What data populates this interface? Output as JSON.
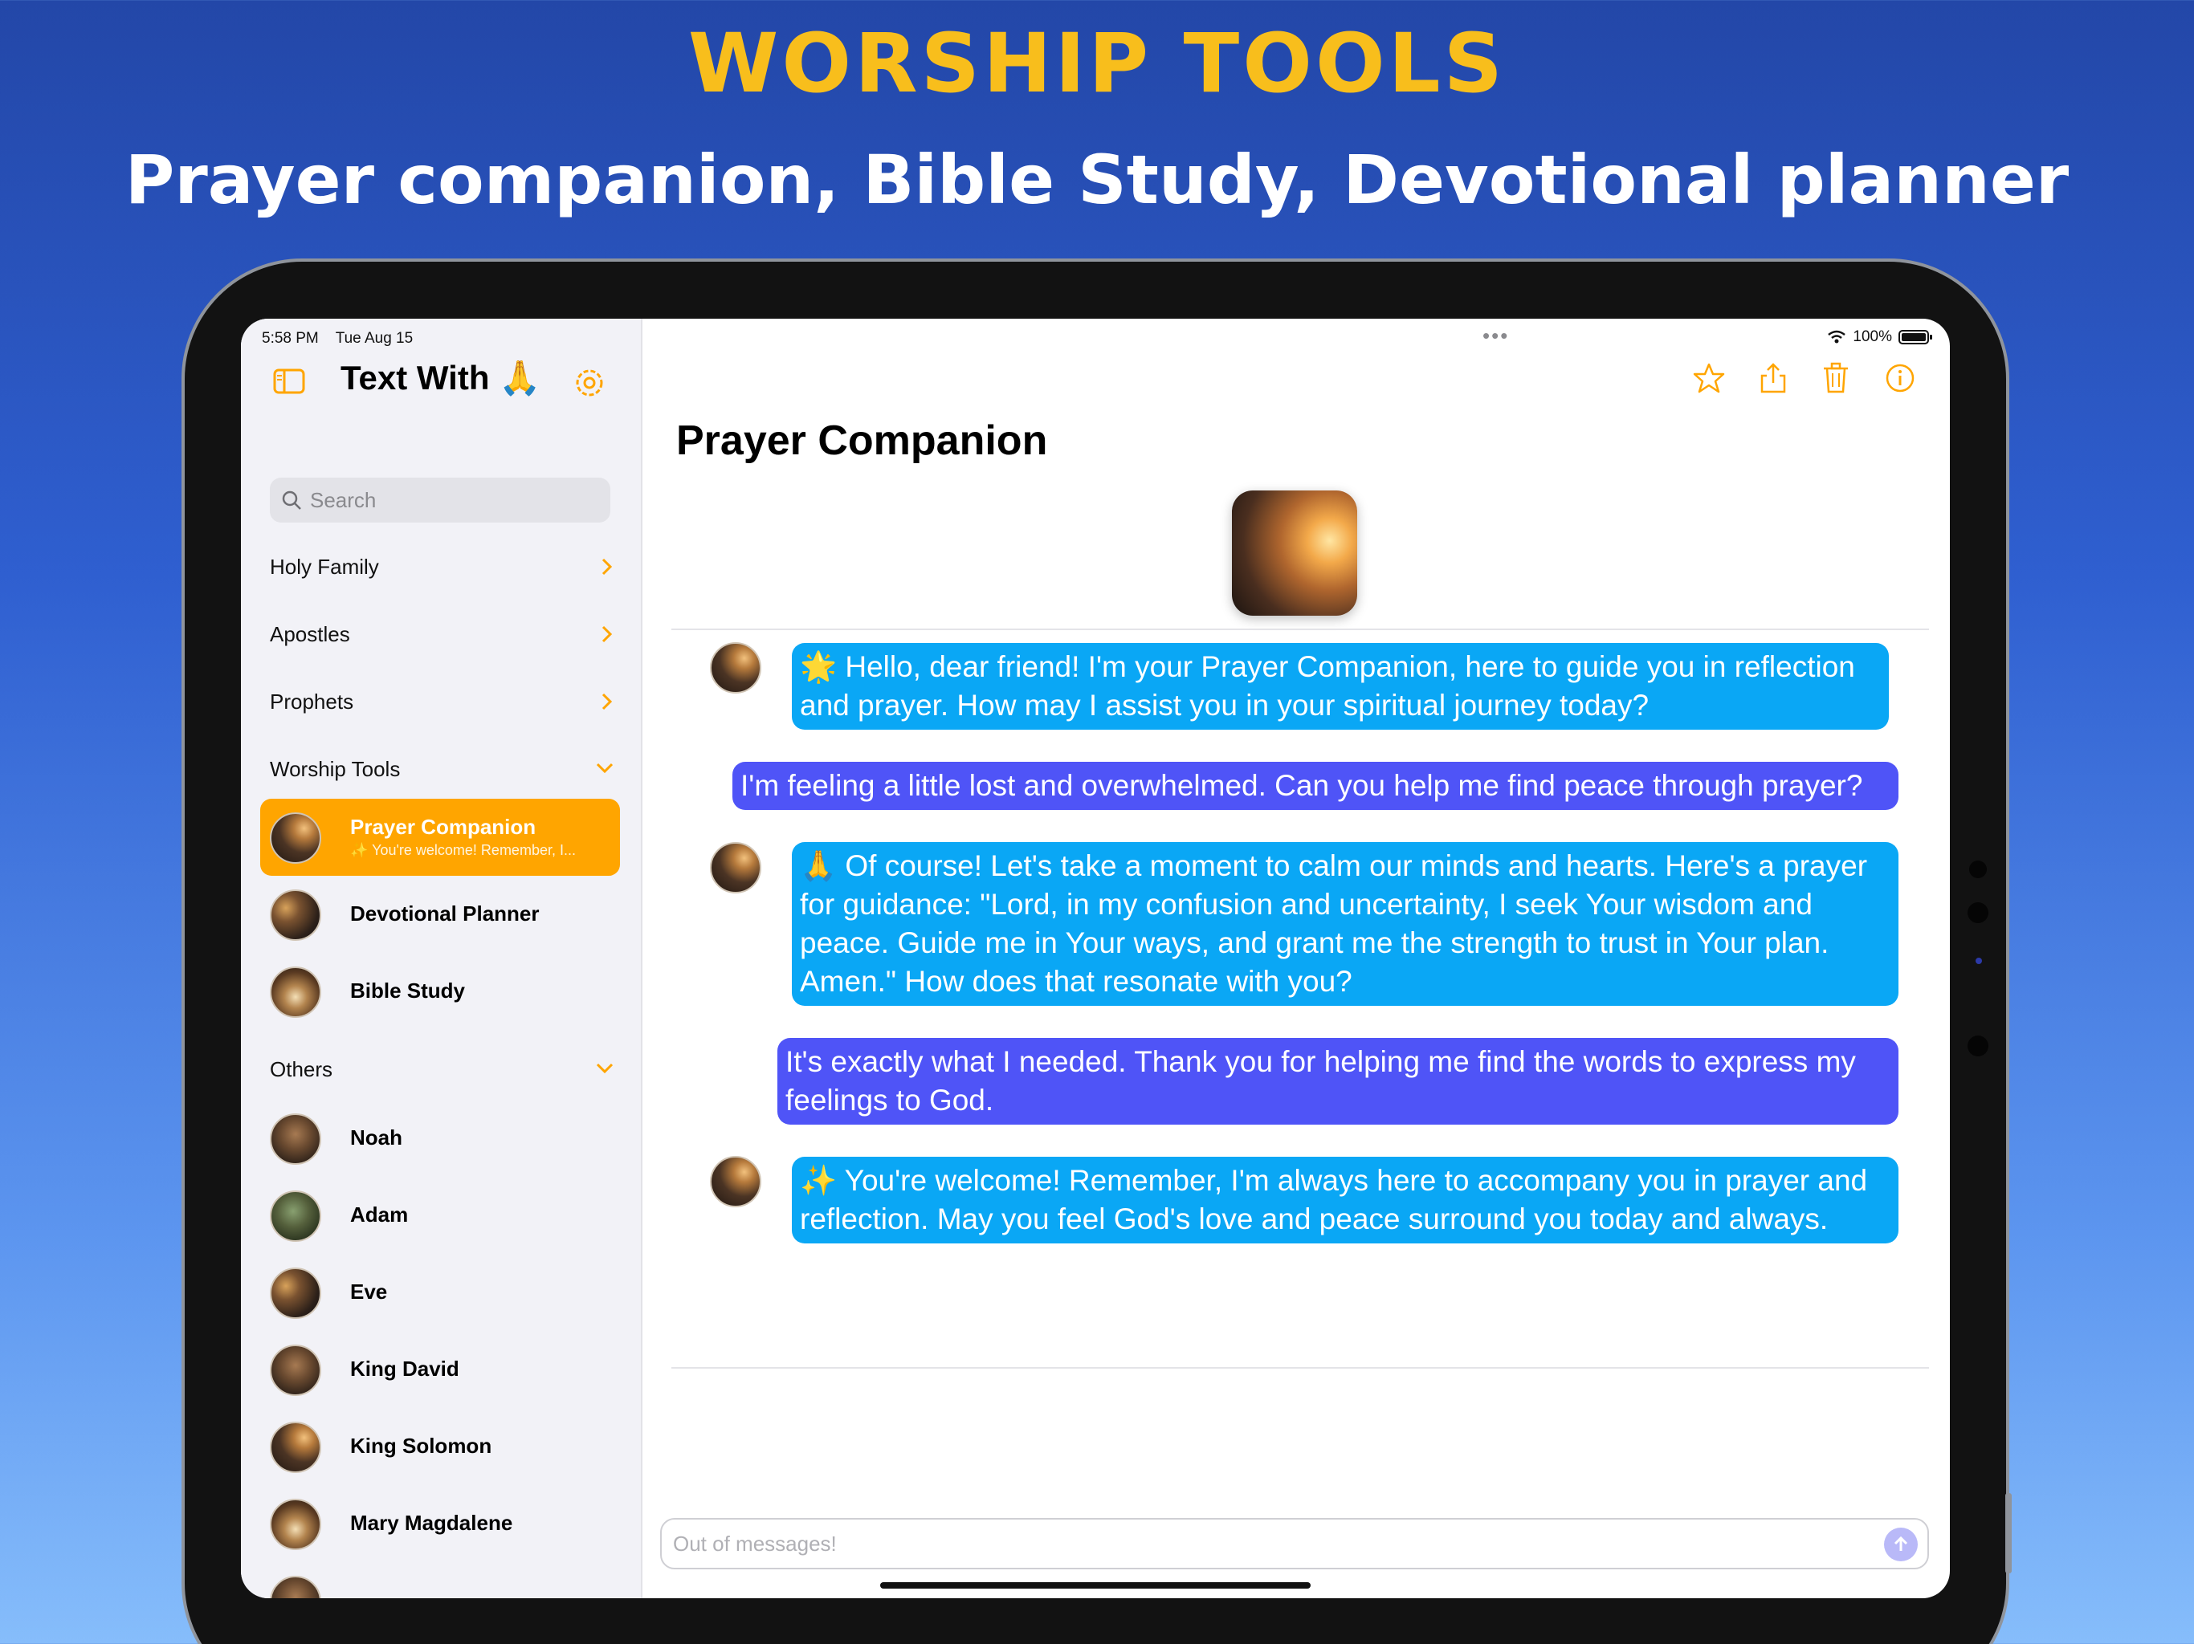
{
  "promo": {
    "title": "WORSHIP TOOLS",
    "subtitle": "Prayer companion, Bible Study, Devotional planner"
  },
  "status_bar": {
    "time": "5:58 PM",
    "date": "Tue Aug 15",
    "battery": "100%",
    "battery_level": 1.0
  },
  "sidebar": {
    "app_title": "Text With 🙏",
    "search_placeholder": "Search",
    "sections": [
      {
        "label": "Holy Family",
        "state": "collapsed"
      },
      {
        "label": "Apostles",
        "state": "collapsed"
      },
      {
        "label": "Prophets",
        "state": "collapsed"
      },
      {
        "label": "Worship Tools",
        "state": "expanded"
      }
    ],
    "worship_tools": [
      {
        "name": "Prayer Companion",
        "preview": "✨ You're welcome! Remember, I...",
        "selected": true
      },
      {
        "name": "Devotional Planner"
      },
      {
        "name": "Bible Study"
      }
    ],
    "others_label": "Others",
    "others": [
      {
        "name": "Noah"
      },
      {
        "name": "Adam"
      },
      {
        "name": "Eve"
      },
      {
        "name": "King David"
      },
      {
        "name": "King Solomon"
      },
      {
        "name": "Mary Magdalene"
      }
    ]
  },
  "chat": {
    "title": "Prayer Companion",
    "messages": [
      {
        "role": "assistant",
        "text": "🌟 Hello, dear friend! I'm your Prayer Companion, here to guide you in reflection and prayer. How may I assist you in your spiritual journey today?"
      },
      {
        "role": "user",
        "text": "I'm feeling a little lost and overwhelmed. Can you help me find peace through prayer?"
      },
      {
        "role": "assistant",
        "text": "🙏 Of course! Let's take a moment to calm our minds and hearts. Here's a prayer for guidance: \"Lord, in my confusion and uncertainty, I seek Your wisdom and peace. Guide me in Your ways, and grant me the strength to trust in Your plan. Amen.\" How does that resonate with you?"
      },
      {
        "role": "user",
        "text": "It's exactly what I needed. Thank you for helping me find the words to express my feelings to God."
      },
      {
        "role": "assistant",
        "text": "✨ You're welcome! Remember, I'm always here to accompany you in prayer and reflection. May you feel God's love and peace surround you today and always."
      }
    ],
    "composer_placeholder": "Out of messages!"
  },
  "toolbar_icons": [
    "star-icon",
    "share-icon",
    "trash-icon",
    "info-icon"
  ],
  "colors": {
    "accent": "#ffa500",
    "assistant_bubble": "#0aa7f5",
    "user_bubble": "#4f54f7",
    "promo_title": "#f8be1c"
  }
}
